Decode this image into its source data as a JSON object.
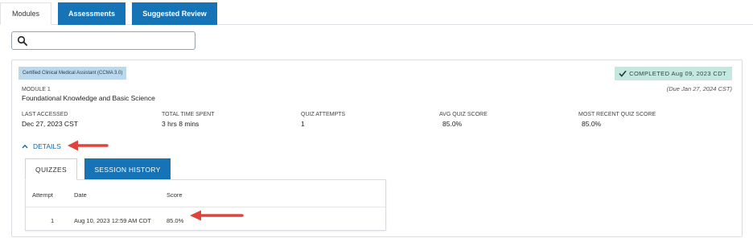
{
  "tabs": {
    "modules": "Modules",
    "assessments": "Assessments",
    "suggested_review": "Suggested Review"
  },
  "search": {
    "placeholder": "",
    "value": ""
  },
  "module": {
    "badge": "Certified Clinical Medical Assistant (CCMA 3.0)",
    "completed": "COMPLETED Aug 09, 2023 CDT",
    "due": "(Due Jan 27, 2024 CST)",
    "number": "MODULE 1",
    "title": "Foundational Knowledge and Basic Science",
    "stats": [
      {
        "label": "LAST ACCESSED",
        "value": "Dec 27, 2023 CST"
      },
      {
        "label": "TOTAL TIME SPENT",
        "value": "3 hrs 8 mins"
      },
      {
        "label": "QUIZ ATTEMPTS",
        "value": "1"
      },
      {
        "label": "AVG QUIZ SCORE",
        "value": "85.0%"
      },
      {
        "label": "MOST RECENT QUIZ SCORE",
        "value": "85.0%"
      }
    ],
    "details_label": "DETAILS"
  },
  "detail_tabs": {
    "quizzes": "QUIZZES",
    "session_history": "SESSION HISTORY"
  },
  "quiz_table": {
    "headers": {
      "attempt": "Attempt",
      "date": "Date",
      "score": "Score"
    },
    "rows": [
      {
        "attempt": "1",
        "date": "Aug 10, 2023 12:59 AM CDT",
        "score": "85.0%"
      }
    ]
  },
  "colors": {
    "primary_blue": "#1573b6",
    "badge_bg": "#bcd8ec",
    "completed_bg": "#c4e8df",
    "annotation_arrow": "#e0433c"
  },
  "icons": {
    "search": "search-icon",
    "check": "check-icon",
    "details_toggle": "chevron-up-icon",
    "annotation": "red-arrow-icon"
  }
}
